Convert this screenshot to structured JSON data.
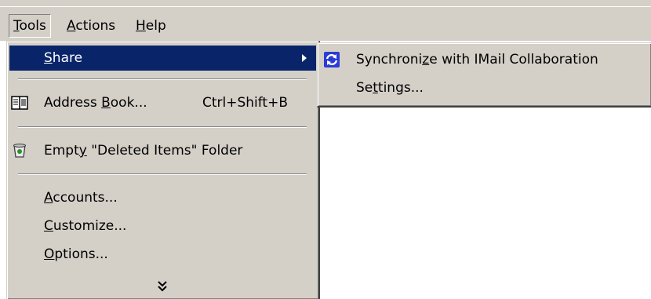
{
  "menubar": {
    "items": [
      {
        "label": "Tools",
        "mnemonic": "T"
      },
      {
        "label": "Actions",
        "mnemonic": "A"
      },
      {
        "label": "Help",
        "mnemonic": "H"
      }
    ]
  },
  "tools_menu": {
    "share": {
      "label": "Share",
      "mnemonic": "S"
    },
    "address_book": {
      "label": "Address Book...",
      "mnemonic": "B",
      "shortcut": "Ctrl+Shift+B",
      "icon": "address-book-icon"
    },
    "empty_deleted": {
      "label": "Empty \"Deleted Items\" Folder",
      "mnemonic": "y",
      "icon": "recycle-bin-icon"
    },
    "accounts": {
      "label": "Accounts...",
      "mnemonic": "A"
    },
    "customize": {
      "label": "Customize...",
      "mnemonic": "C"
    },
    "options": {
      "label": "Options...",
      "mnemonic": "O"
    },
    "more_icon": "double-chevron-down-icon"
  },
  "share_submenu": {
    "synchronize": {
      "label": "Synchronize with IMail Collaboration",
      "mnemonic": "z",
      "icon": "sync-icon"
    },
    "settings": {
      "label": "Settings...",
      "mnemonic": "t"
    }
  },
  "colors": {
    "menu_background": "#d4d0c8",
    "highlight": "#0a246a",
    "highlight_text": "#ffffff"
  }
}
